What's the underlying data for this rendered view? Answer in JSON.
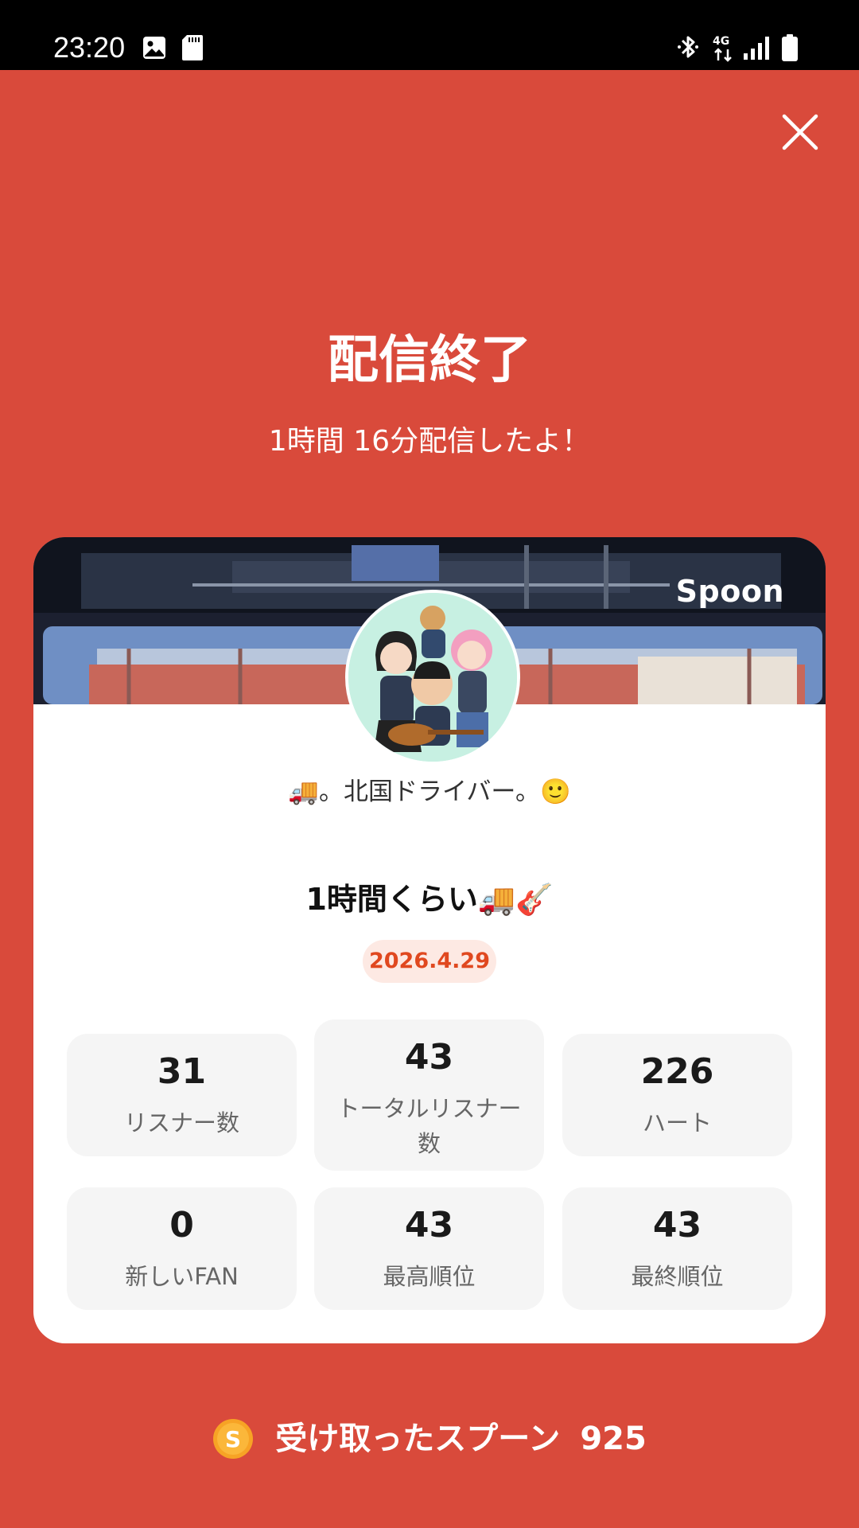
{
  "status_bar": {
    "time": "23:20",
    "network": "4G"
  },
  "header": {
    "title": "配信終了",
    "subtitle": "1時間 16分配信したよ！"
  },
  "card": {
    "brand": "Spoon",
    "profile_name": "🚚。北国ドライバー。🙂",
    "live_title": "1時間くらい🚚🎸",
    "date": "2026.4.29",
    "stats": [
      {
        "value": "31",
        "label": "リスナー数"
      },
      {
        "value": "43",
        "label": "トータルリスナー数"
      },
      {
        "value": "226",
        "label": "ハート"
      },
      {
        "value": "0",
        "label": "新しいFAN"
      },
      {
        "value": "43",
        "label": "最高順位"
      },
      {
        "value": "43",
        "label": "最終順位"
      }
    ]
  },
  "footer": {
    "label": "受け取ったスプーン",
    "count": "925",
    "coin_letter": "S"
  },
  "colors": {
    "background": "#d94a3b",
    "accent": "#e0481f",
    "badge_bg": "#fde9e3",
    "stat_bg": "#f5f5f5"
  },
  "icons": {
    "close": "close-icon",
    "gallery": "gallery-icon",
    "sd_card": "sd-card-icon",
    "bluetooth": "bluetooth-icon",
    "signal": "signal-icon",
    "battery": "battery-icon",
    "coin": "spoon-coin-icon"
  }
}
